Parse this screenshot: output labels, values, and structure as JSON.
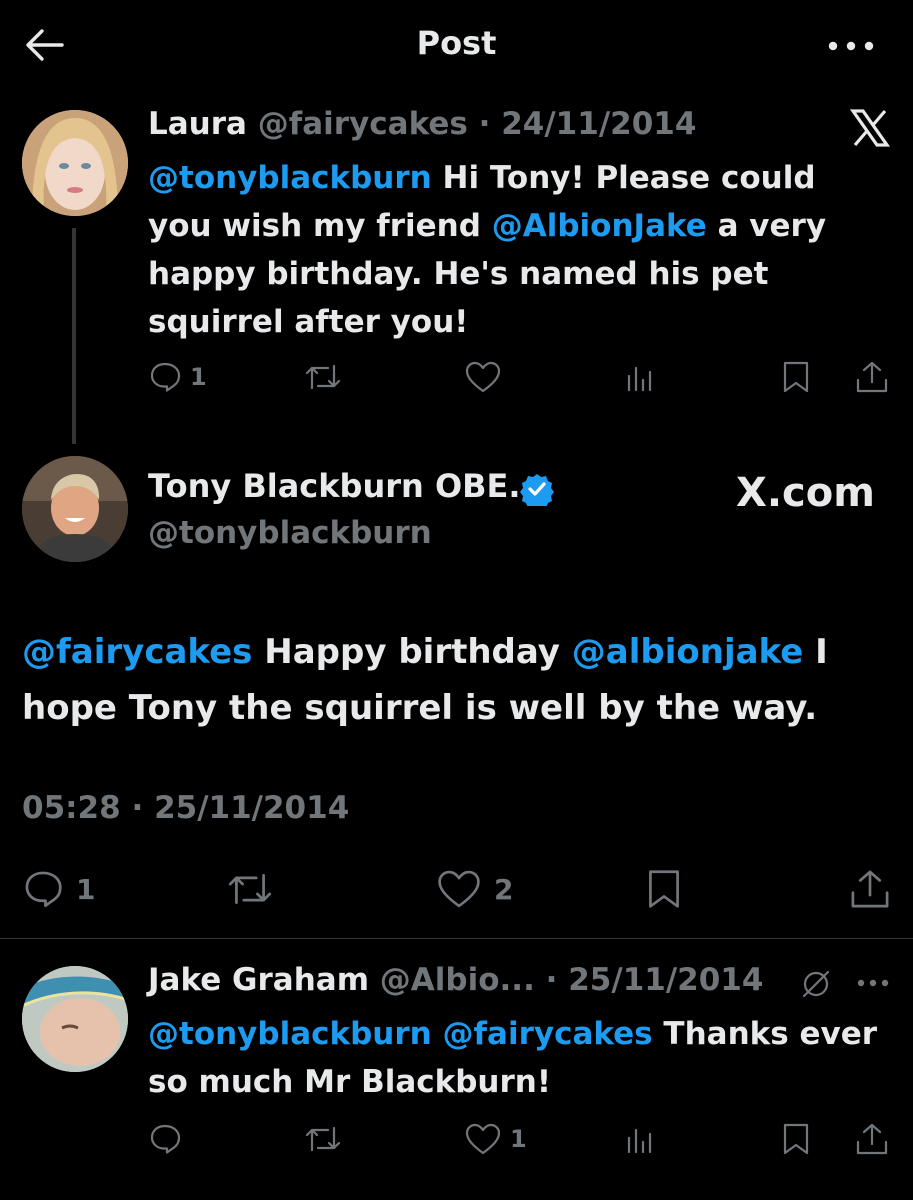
{
  "header": {
    "title": "Post"
  },
  "tweets": {
    "laura": {
      "name": "Laura",
      "handle": "@fairycakes",
      "sep": " · ",
      "date": "24/11/2014",
      "mention1": "@tonyblackburn",
      "text1": " Hi Tony! Please could you wish my friend ",
      "mention2": "@AlbionJake",
      "text2": " a very happy birthday. He's named his pet squirrel after you!",
      "reply_count": "1"
    },
    "tony": {
      "name": "Tony Blackburn OBE.",
      "handle": "@tonyblackburn",
      "watermark": "X.com",
      "mention1": "@fairycakes",
      "text1": " Happy birthday ",
      "mention2": "@albionjake",
      "text2": "  I hope Tony the squirrel is well by the way.",
      "time": "05:28",
      "sep": " · ",
      "date": "25/11/2014",
      "reply_count": "1",
      "like_count": "2"
    },
    "jake": {
      "name": "Jake Graham",
      "handle": "@Albio...",
      "sep": " · ",
      "date": "25/11/2014",
      "mention1": "@tonyblackburn",
      "mention2": "@fairycakes",
      "text": " Thanks ever so much Mr Blackburn!",
      "like_count": "1"
    }
  },
  "icons": {
    "back": "arrow-left-icon",
    "more": "more-horizontal-icon",
    "x_logo": "x-logo-icon",
    "verified": "verified-badge-icon",
    "reply": "reply-icon",
    "retweet": "retweet-icon",
    "like": "heart-icon",
    "views": "views-icon",
    "bookmark": "bookmark-icon",
    "share": "share-icon",
    "no_sign": "slash-circle-icon"
  },
  "colors": {
    "background": "#000000",
    "text": "#e7e9ea",
    "secondary": "#71767b",
    "accent": "#1d9bf0"
  }
}
